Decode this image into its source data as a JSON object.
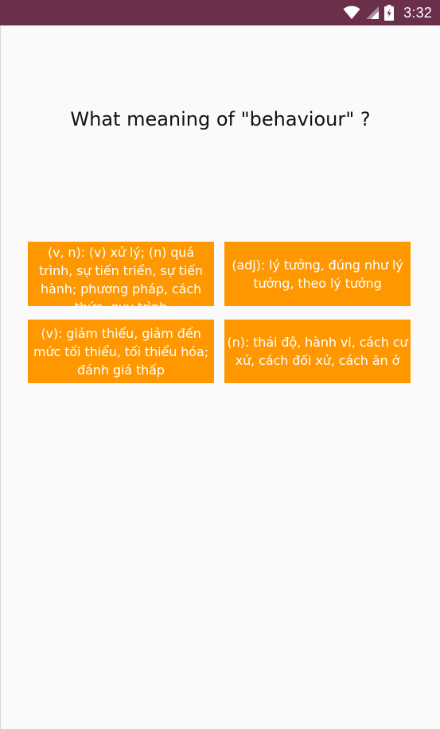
{
  "status_bar": {
    "time": "3:32",
    "icons": [
      "wifi-icon",
      "signal-icon",
      "battery-icon"
    ],
    "background": "#6a2f4a"
  },
  "quiz": {
    "question": "What meaning of \"behaviour\" ?",
    "answers": [
      {
        "label": "(v, n): (v) xử lý; (n) quá trình, sự tiến triển, sự tiến hành; phương pháp, cách thức, quy trình"
      },
      {
        "label": "(adj): lý tưởng, đúng như lý tưởng, theo lý tưởng"
      },
      {
        "label": "(v): giảm thiểu, giảm đến mức tối thiểu, tối thiểu hóa; đánh giá thấp"
      },
      {
        "label": "(n): thái độ, hành vi, cách cư xử, cách đối xử, cách ăn ở"
      }
    ],
    "answer_color": "#ff9800"
  }
}
